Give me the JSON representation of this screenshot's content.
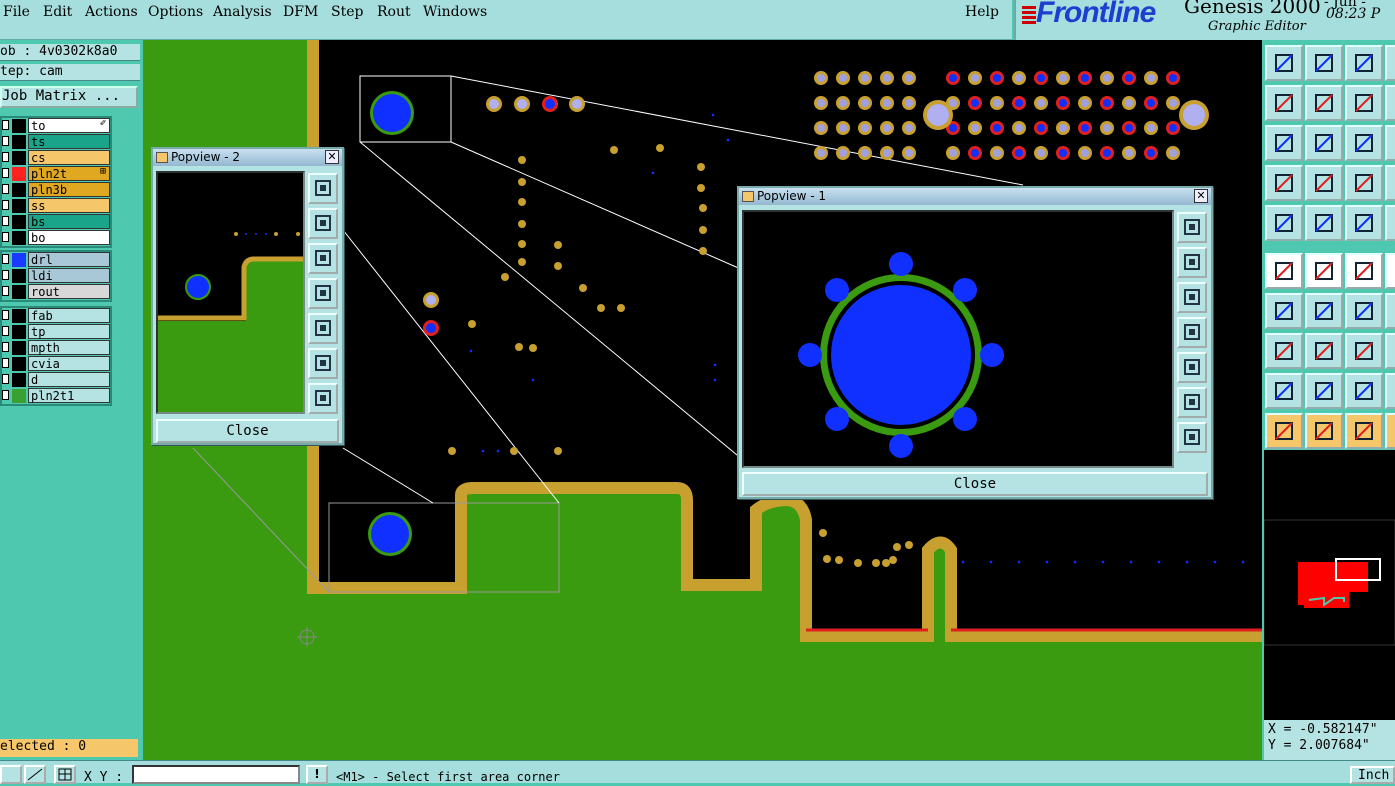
{
  "menu": {
    "items": [
      {
        "label": "File",
        "ul": "F"
      },
      {
        "label": "Edit",
        "ul": "E"
      },
      {
        "label": "Actions",
        "ul": "A"
      },
      {
        "label": "Options",
        "ul": "O"
      },
      {
        "label": "Analysis",
        "ul": "A"
      },
      {
        "label": "DFM",
        "ul": "D"
      },
      {
        "label": "Step",
        "ul": "S"
      },
      {
        "label": "Rout",
        "ul": "R"
      },
      {
        "label": "Windows",
        "ul": "W"
      }
    ],
    "help": "Help"
  },
  "brand": {
    "logo": "Frontline",
    "product": "Genesis 2000",
    "subtitle": "Graphic Editor",
    "date": "- Jun -",
    "time": "08:23 P"
  },
  "job": {
    "job_line": "ob : 4v0302k8a0",
    "step_line": "tep: cam",
    "matrix_button": "Job Matrix ..."
  },
  "layers": {
    "group1": [
      {
        "name": "to",
        "color": "#ffffff",
        "swatch": "#000000",
        "mark": "✐"
      },
      {
        "name": "ts",
        "color": "#1aa58a",
        "swatch": "#000000"
      },
      {
        "name": "cs",
        "color": "#f6c76a",
        "swatch": "#000000"
      },
      {
        "name": "pln2t",
        "color": "#e0a820",
        "swatch": "#ff2020",
        "mark": "⊞"
      },
      {
        "name": "pln3b",
        "color": "#e0a820",
        "swatch": "#000000"
      },
      {
        "name": "ss",
        "color": "#f6c76a",
        "swatch": "#000000"
      },
      {
        "name": "bs",
        "color": "#1aa58a",
        "swatch": "#000000"
      },
      {
        "name": "bo",
        "color": "#ffffff",
        "swatch": "#000000"
      }
    ],
    "group2": [
      {
        "name": "drl",
        "color": "#a8c8d8",
        "swatch": "#1a3aff"
      },
      {
        "name": "ldi",
        "color": "#a8c8d8",
        "swatch": "#000000"
      },
      {
        "name": "rout",
        "color": "#d8d8d8",
        "swatch": "#000000"
      }
    ],
    "group3": [
      {
        "name": "fab",
        "color": "#b5e3e3",
        "swatch": "#000000"
      },
      {
        "name": "tp",
        "color": "#b5e3e3",
        "swatch": "#000000"
      },
      {
        "name": "mpth",
        "color": "#b5e3e3",
        "swatch": "#000000"
      },
      {
        "name": "cvia",
        "color": "#b5e3e3",
        "swatch": "#000000"
      },
      {
        "name": "d",
        "color": "#b5e3e3",
        "swatch": "#000000"
      },
      {
        "name": "pln2t1",
        "color": "#b5e3e3",
        "swatch": "#3aa030"
      }
    ]
  },
  "selected": "elected : 0",
  "popview1": {
    "title": "Popview - 1",
    "close": "Close"
  },
  "popview2": {
    "title": "Popview - 2",
    "close": "Close"
  },
  "coords": {
    "x": "X = -0.582147\"",
    "y": "Y = 2.007684\""
  },
  "status": {
    "xy_label": "X Y :",
    "prompt": "<M1> - Select first area corner",
    "units": "Inch"
  },
  "colors": {
    "copper": "#c8a030",
    "board": "#3a9a10",
    "pad": "#1030ff",
    "accent": "#e02020"
  }
}
